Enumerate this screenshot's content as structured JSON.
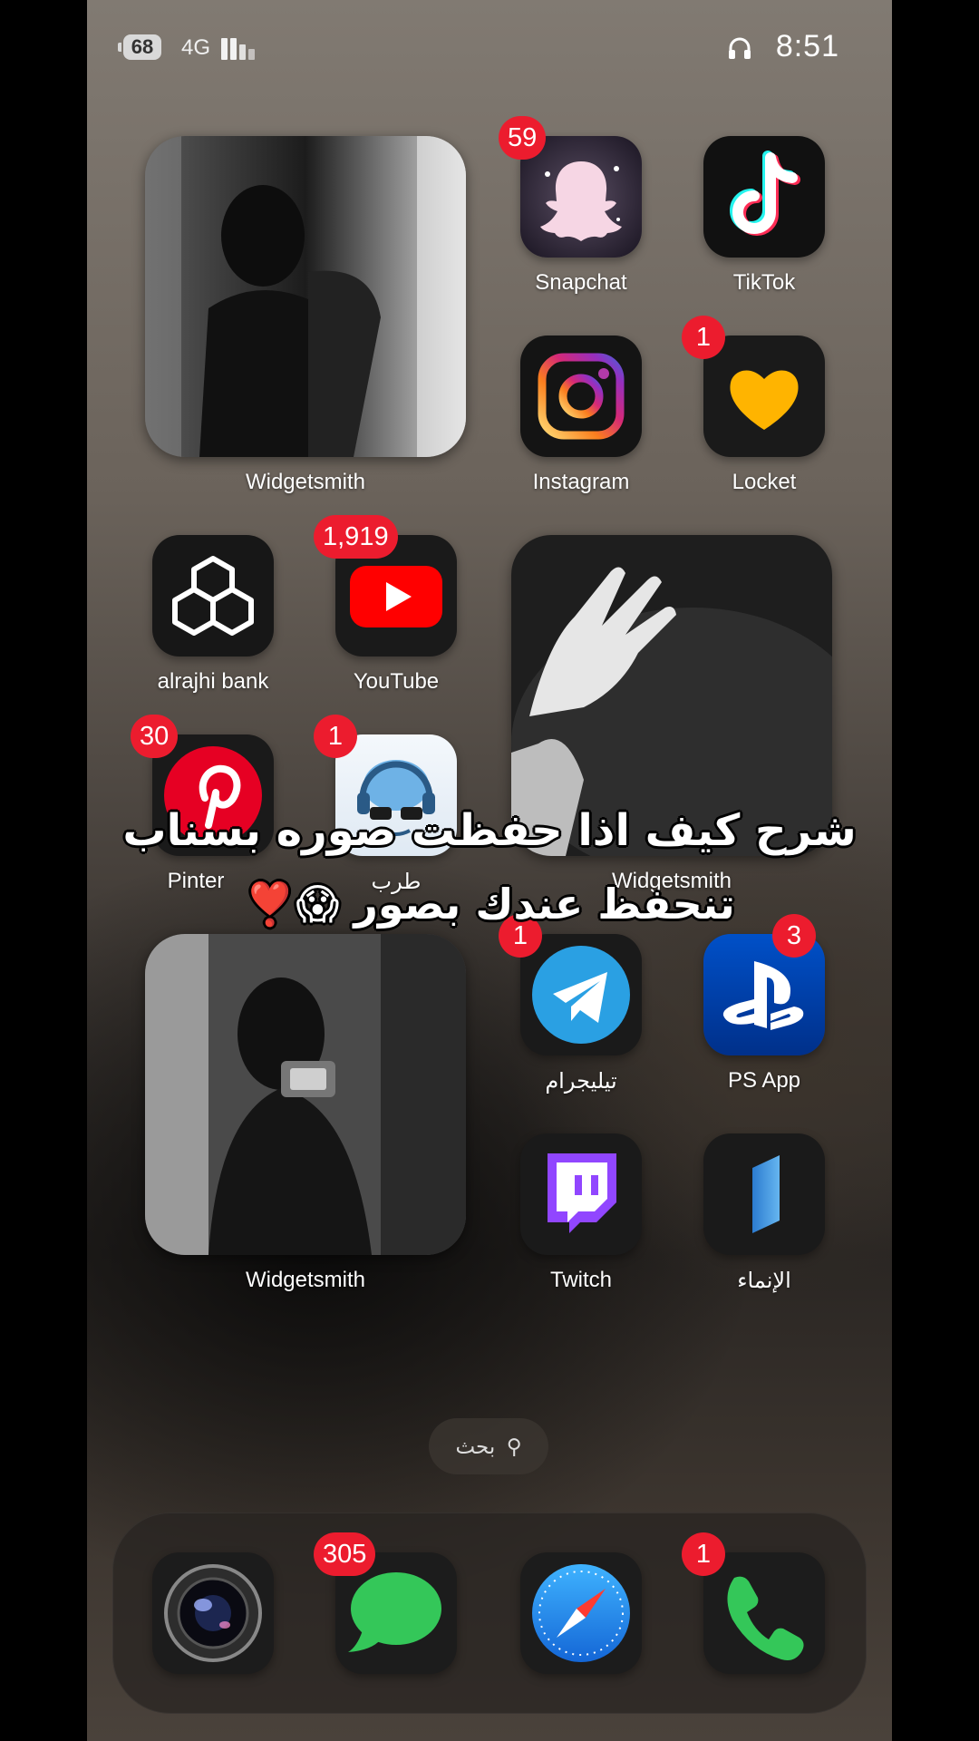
{
  "status_bar": {
    "battery": "68",
    "network": "4G",
    "time": "8:51"
  },
  "home": {
    "widget1_label": "Widgetsmith",
    "widget2_label": "Widgetsmith",
    "widget3_label": "Widgetsmith",
    "apps": {
      "snapchat": {
        "label": "Snapchat",
        "badge": "59"
      },
      "tiktok": {
        "label": "TikTok"
      },
      "instagram": {
        "label": "Instagram"
      },
      "locket": {
        "label": "Locket",
        "badge": "1"
      },
      "alrajhi": {
        "label": "alrajhi bank"
      },
      "youtube": {
        "label": "YouTube",
        "badge": "1,919"
      },
      "pinterest": {
        "label": "Pinter",
        "badge": "30"
      },
      "tarab": {
        "label": "طرب",
        "badge": "1"
      },
      "telegram": {
        "label": "تيليجرام",
        "badge": "1"
      },
      "psapp": {
        "label": "PS App",
        "badge": "3"
      },
      "twitch": {
        "label": "Twitch"
      },
      "alinmaa": {
        "label": "الإنماء"
      }
    },
    "search_label": "بحث"
  },
  "overlay_text": {
    "line1": "شرح كيف اذا حفظت صوره بسناب",
    "line2": "تنحفظ عندك بصور 😱❣️"
  },
  "dock": {
    "messages_badge": "305",
    "phone_badge": "1"
  },
  "colors": {
    "badge": "#ec1c2e",
    "youtube": "#ff0000",
    "telegram": "#2aa0e3",
    "twitch": "#9146ff",
    "playstation": "#003e9a"
  }
}
